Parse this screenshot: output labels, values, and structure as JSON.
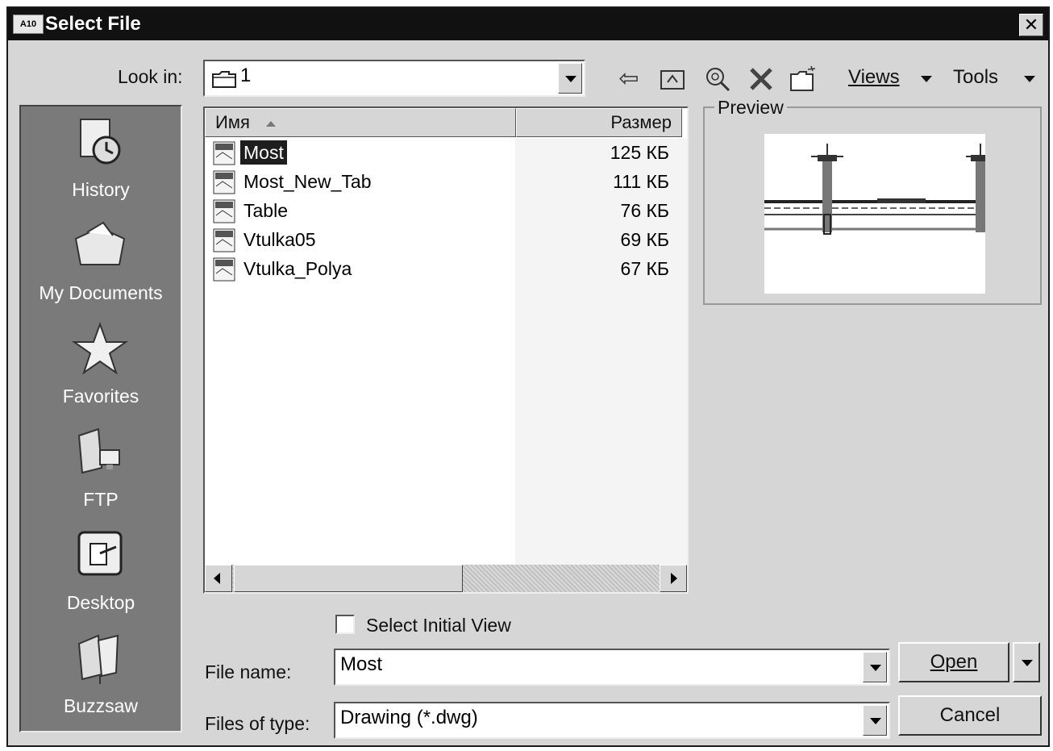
{
  "window": {
    "title": "Select File",
    "app_badge": "A10",
    "close_glyph": "✕"
  },
  "toolbar": {
    "look_in_label": "Look in:",
    "look_in_value": "1",
    "views_label": "Views",
    "tools_label": "Tools",
    "icons": [
      "back-icon",
      "up-folder-icon",
      "search-web-icon",
      "delete-icon",
      "new-folder-icon"
    ]
  },
  "places": [
    {
      "label": "History",
      "icon": "history-icon"
    },
    {
      "label": "My Documents",
      "icon": "my-documents-icon"
    },
    {
      "label": "Favorites",
      "icon": "favorites-star-icon"
    },
    {
      "label": "FTP",
      "icon": "ftp-icon"
    },
    {
      "label": "Desktop",
      "icon": "desktop-icon"
    },
    {
      "label": "Buzzsaw",
      "icon": "buzzsaw-icon"
    }
  ],
  "filelist": {
    "columns": {
      "name": "Имя",
      "size": "Размер"
    },
    "files": [
      {
        "name": "Most",
        "size": "125 КБ",
        "selected": true
      },
      {
        "name": "Most_New_Tab",
        "size": "111 КБ",
        "selected": false
      },
      {
        "name": "Table",
        "size": "76 КБ",
        "selected": false
      },
      {
        "name": "Vtulka05",
        "size": "69 КБ",
        "selected": false
      },
      {
        "name": "Vtulka_Polya",
        "size": "67 КБ",
        "selected": false
      }
    ]
  },
  "preview": {
    "label": "Preview"
  },
  "options": {
    "select_initial_view": "Select Initial View",
    "checked": false
  },
  "form": {
    "file_name_label": "File name:",
    "file_name_value": "Most",
    "file_type_label": "Files of type:",
    "file_type_value": "Drawing (*.dwg)"
  },
  "buttons": {
    "open": "Open",
    "cancel": "Cancel"
  },
  "colors": {
    "titlebar": "#111111",
    "dialog_bg": "#d6d6d6",
    "places_bg": "#7a7a7a",
    "selection": "#1e1e1e"
  }
}
